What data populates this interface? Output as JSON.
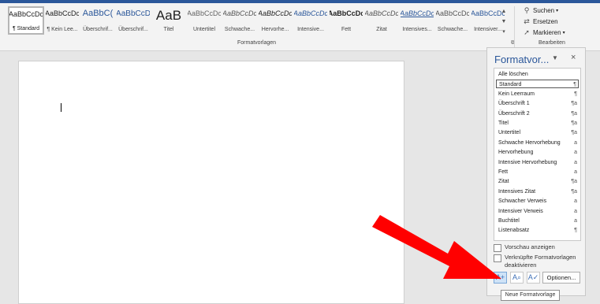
{
  "ribbon": {
    "styles_gallery": [
      {
        "preview": "AaBbCcDc",
        "label": "¶ Standard",
        "selected": true
      },
      {
        "preview": "AaBbCcDc",
        "label": "¶ Kein Lee...",
        "selected": false
      },
      {
        "preview": "AaBbC(",
        "label": "Überschrif...",
        "selected": false
      },
      {
        "preview": "AaBbCcD",
        "label": "Überschrif...",
        "selected": false
      },
      {
        "preview": "AaB",
        "label": "Titel",
        "selected": false
      },
      {
        "preview": "AaBbCcDc",
        "label": "Untertitel",
        "selected": false
      },
      {
        "preview": "AaBbCcDc",
        "label": "Schwache...",
        "selected": false
      },
      {
        "preview": "AaBbCcDc",
        "label": "Hervorhe...",
        "selected": false
      },
      {
        "preview": "AaBbCcDc",
        "label": "Intensive...",
        "selected": false
      },
      {
        "preview": "AaBbCcDc",
        "label": "Fett",
        "selected": false
      },
      {
        "preview": "AaBbCcDc",
        "label": "Zitat",
        "selected": false
      },
      {
        "preview": "AaBbCcDc",
        "label": "Intensives...",
        "selected": false
      },
      {
        "preview": "AaBbCcDc",
        "label": "Schwache...",
        "selected": false
      },
      {
        "preview": "AaBbCcDc",
        "label": "Intensiver...",
        "selected": false
      }
    ],
    "group_styles_label": "Formatvorlagen",
    "group_edit_label": "Bearbeiten",
    "edit": {
      "search": "Suchen",
      "search_arrow": "▾",
      "replace": "Ersetzen",
      "select": "Markieren",
      "select_arrow": "▾"
    }
  },
  "pane": {
    "title": "Formatvor...",
    "title_dropdown": "▼",
    "close": "×",
    "styles": [
      {
        "name": "Alle löschen",
        "marker": ""
      },
      {
        "name": "Standard",
        "marker": "¶",
        "current": true
      },
      {
        "name": "Kein Leerraum",
        "marker": "¶"
      },
      {
        "name": "Überschrift 1",
        "marker": "¶a"
      },
      {
        "name": "Überschrift 2",
        "marker": "¶a"
      },
      {
        "name": "Titel",
        "marker": "¶a"
      },
      {
        "name": "Untertitel",
        "marker": "¶a"
      },
      {
        "name": "Schwache Hervorhebung",
        "marker": "a"
      },
      {
        "name": "Hervorhebung",
        "marker": "a"
      },
      {
        "name": "Intensive Hervorhebung",
        "marker": "a"
      },
      {
        "name": "Fett",
        "marker": "a"
      },
      {
        "name": "Zitat",
        "marker": "¶a"
      },
      {
        "name": "Intensives Zitat",
        "marker": "¶a"
      },
      {
        "name": "Schwacher Verweis",
        "marker": "a"
      },
      {
        "name": "Intensiver Verweis",
        "marker": "a"
      },
      {
        "name": "Buchtitel",
        "marker": "a"
      },
      {
        "name": "Listenabsatz",
        "marker": "¶"
      }
    ],
    "preview_checkbox": "Vorschau anzeigen",
    "linked_checkbox": "Verknüpfte Formatvorlagen deaktivieren",
    "options_button": "Optionen...",
    "tooltip": "Neue Formatvorlage"
  },
  "colors": {
    "accent": "#2b579a",
    "arrow": "#ff0000"
  }
}
